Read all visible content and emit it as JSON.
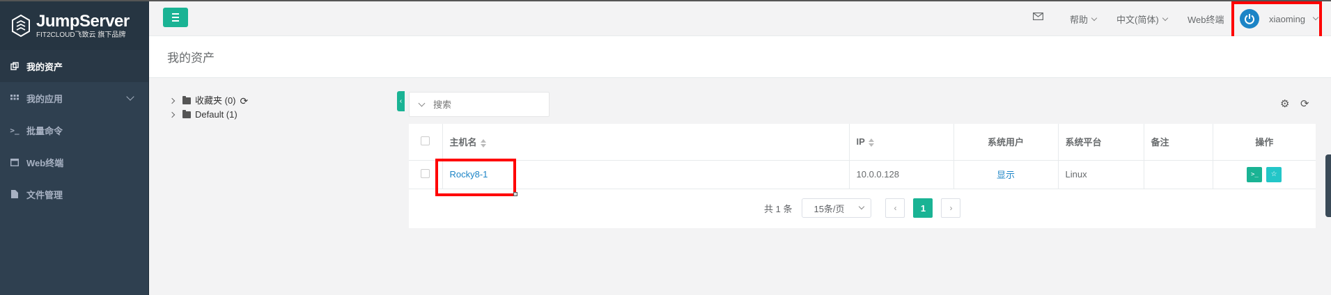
{
  "brand": {
    "name": "JumpServer",
    "sub": "FIT2CLOUD飞致云 旗下品牌"
  },
  "sidebar": {
    "items": [
      {
        "label": "我的资产",
        "icon": "assets-icon"
      },
      {
        "label": "我的应用",
        "icon": "grid-icon"
      },
      {
        "label": "批量命令",
        "icon": "terminal-icon"
      },
      {
        "label": "Web终端",
        "icon": "window-icon"
      },
      {
        "label": "文件管理",
        "icon": "file-icon"
      }
    ]
  },
  "header": {
    "help": "帮助",
    "language": "中文(简体)",
    "web_terminal": "Web终端",
    "username": "xiaoming"
  },
  "page": {
    "title": "我的资产"
  },
  "tree": {
    "favorites": "收藏夹 (0)",
    "default": "Default (1)"
  },
  "search": {
    "placeholder": "搜索"
  },
  "table": {
    "headers": [
      "主机名",
      "IP",
      "系统用户",
      "系统平台",
      "备注",
      "操作"
    ],
    "rows": [
      {
        "hostname": "Rocky8-1",
        "ip": "10.0.0.128",
        "system_user": "显示",
        "platform": "Linux",
        "comment": ""
      }
    ]
  },
  "pagination": {
    "total": "共 1 条",
    "page_size": "15条/页",
    "current": "1"
  },
  "colors": {
    "accent": "#1ab394",
    "sidebar": "#2f4050",
    "link": "#1c84c6",
    "highlight": "#ff0000"
  }
}
